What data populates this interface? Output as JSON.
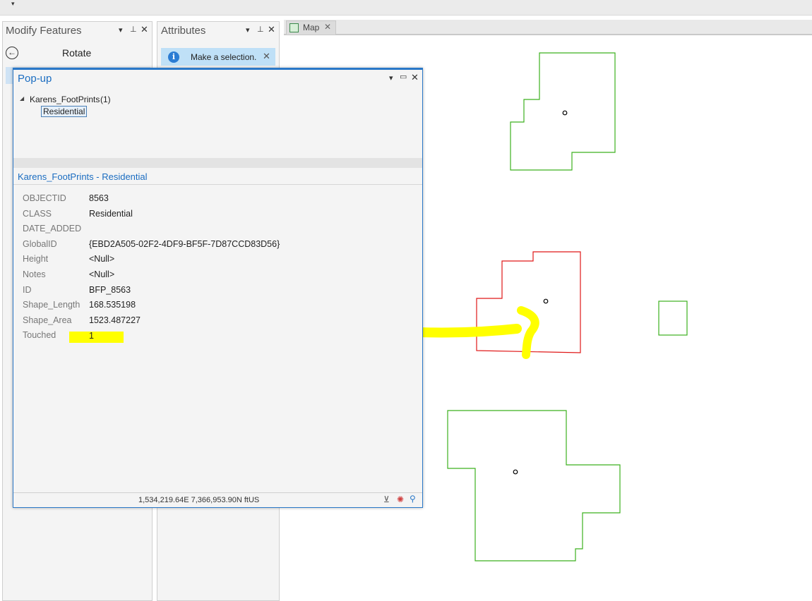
{
  "ribbon": {
    "caret": "▾"
  },
  "modify_pane": {
    "title": "Modify Features",
    "controls": [
      "▾",
      "⊥",
      "✕"
    ],
    "tool": "Rotate"
  },
  "attributes_pane": {
    "title": "Attributes",
    "controls": [
      "▾",
      "⊥",
      "✕"
    ],
    "message": "Make a selection.",
    "close": "✕",
    "info": "i"
  },
  "map_tab": {
    "label": "Map",
    "close": "✕"
  },
  "popup": {
    "title": "Pop-up",
    "controls": [
      "▾",
      "▭",
      "✕"
    ],
    "tree": {
      "expander": "◢",
      "layer": "Karens_FootPrints",
      "count": "(1)",
      "child": "Residential"
    },
    "feature_header": "Karens_FootPrints - Residential",
    "fields": [
      {
        "name": "OBJECTID",
        "value": "8563"
      },
      {
        "name": "CLASS",
        "value": "Residential"
      },
      {
        "name": "DATE_ADDED",
        "value": ""
      },
      {
        "name": "GlobalID",
        "value": "{EBD2A505-02F2-4DF9-BF5F-7D87CCD83D56}"
      },
      {
        "name": "Height",
        "value": "<Null>"
      },
      {
        "name": "Notes",
        "value": "<Null>"
      },
      {
        "name": "ID",
        "value": "BFP_8563"
      },
      {
        "name": "Shape_Length",
        "value": "168.535198"
      },
      {
        "name": "Shape_Area",
        "value": "1523.487227"
      },
      {
        "name": "Touched",
        "value": "1"
      }
    ],
    "coordinates": "1,534,219.64E 7,366,953.90N ftUS"
  },
  "colors": {
    "unselected_outline": "#3cb11e",
    "selected_outline": "#e01818",
    "annotation": "#ffff00",
    "accent": "#2a78c8"
  }
}
